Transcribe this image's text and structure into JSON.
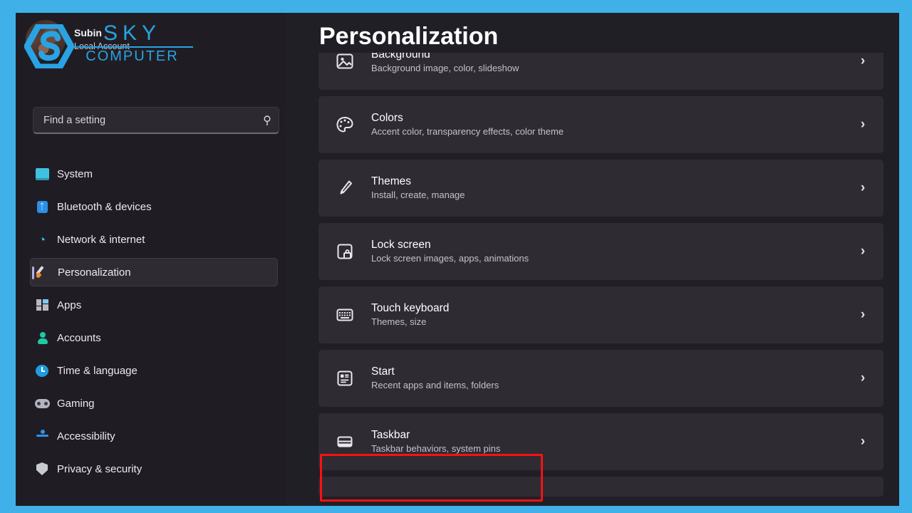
{
  "window": {
    "frame_color": "#3fb1e8",
    "background": "#211f26",
    "sidebar_background": "#1f1d23",
    "row_background": "#2e2b33",
    "accent_color": "#b4b0e8",
    "highlight_color": "#fb1111"
  },
  "watermark": {
    "line1": "SKY",
    "line2": "COMPUTER",
    "color": "#29a3e3"
  },
  "user": {
    "name": "Subin",
    "account_type": "Local Account"
  },
  "search": {
    "placeholder": "Find a setting",
    "value": "",
    "icon": "search-icon"
  },
  "sidebar": {
    "items": [
      {
        "label": "System",
        "icon": "monitor-icon",
        "selected": false
      },
      {
        "label": "Bluetooth & devices",
        "icon": "bluetooth-icon",
        "selected": false
      },
      {
        "label": "Network & internet",
        "icon": "wifi-icon",
        "selected": false
      },
      {
        "label": "Personalization",
        "icon": "paintbrush-icon",
        "selected": true
      },
      {
        "label": "Apps",
        "icon": "apps-icon",
        "selected": false
      },
      {
        "label": "Accounts",
        "icon": "person-icon",
        "selected": false
      },
      {
        "label": "Time & language",
        "icon": "clock-icon",
        "selected": false
      },
      {
        "label": "Gaming",
        "icon": "gamepad-icon",
        "selected": false
      },
      {
        "label": "Accessibility",
        "icon": "accessibility-icon",
        "selected": false
      },
      {
        "label": "Privacy & security",
        "icon": "shield-icon",
        "selected": false
      }
    ]
  },
  "main": {
    "title": "Personalization",
    "chevron": "›",
    "rows": [
      {
        "title": "Background",
        "subtitle": "Background image, color, slideshow",
        "icon": "image-icon",
        "highlighted": false,
        "clipped_top": true
      },
      {
        "title": "Colors",
        "subtitle": "Accent color, transparency effects, color theme",
        "icon": "palette-icon",
        "highlighted": false
      },
      {
        "title": "Themes",
        "subtitle": "Install, create, manage",
        "icon": "paintbrush-icon",
        "highlighted": false
      },
      {
        "title": "Lock screen",
        "subtitle": "Lock screen images, apps, animations",
        "icon": "lock-screen-icon",
        "highlighted": false
      },
      {
        "title": "Touch keyboard",
        "subtitle": "Themes, size",
        "icon": "keyboard-icon",
        "highlighted": false
      },
      {
        "title": "Start",
        "subtitle": "Recent apps and items, folders",
        "icon": "start-icon",
        "highlighted": false
      },
      {
        "title": "Taskbar",
        "subtitle": "Taskbar behaviors, system pins",
        "icon": "taskbar-icon",
        "highlighted": true
      }
    ]
  }
}
